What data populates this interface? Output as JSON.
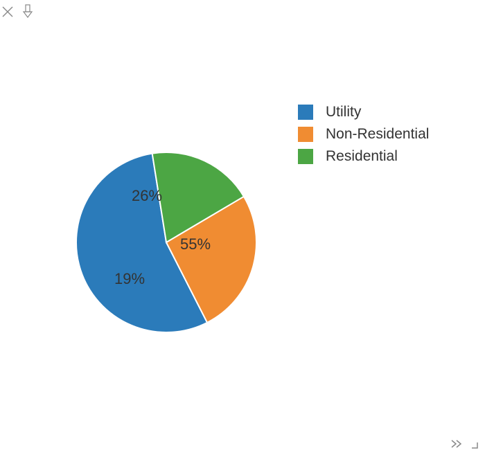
{
  "chart_data": {
    "type": "pie",
    "series": [
      {
        "name": "Utility",
        "value": 55,
        "color": "#2b7bba",
        "label": "55%"
      },
      {
        "name": "Non-Residential",
        "value": 26,
        "color": "#f08c32",
        "label": "26%"
      },
      {
        "name": "Residential",
        "value": 19,
        "color": "#4ca644",
        "label": "19%"
      }
    ],
    "legend_position": "right"
  },
  "legend": {
    "items": [
      {
        "label": "Utility"
      },
      {
        "label": "Non-Residential"
      },
      {
        "label": "Residential"
      }
    ]
  },
  "slice_labels": {
    "utility": "55%",
    "non_residential": "26%",
    "residential": "19%"
  },
  "icons": {
    "close": "close-icon",
    "download": "download-arrow-icon",
    "more": "chevron-double-right-icon",
    "resize": "resize-corner-icon"
  }
}
